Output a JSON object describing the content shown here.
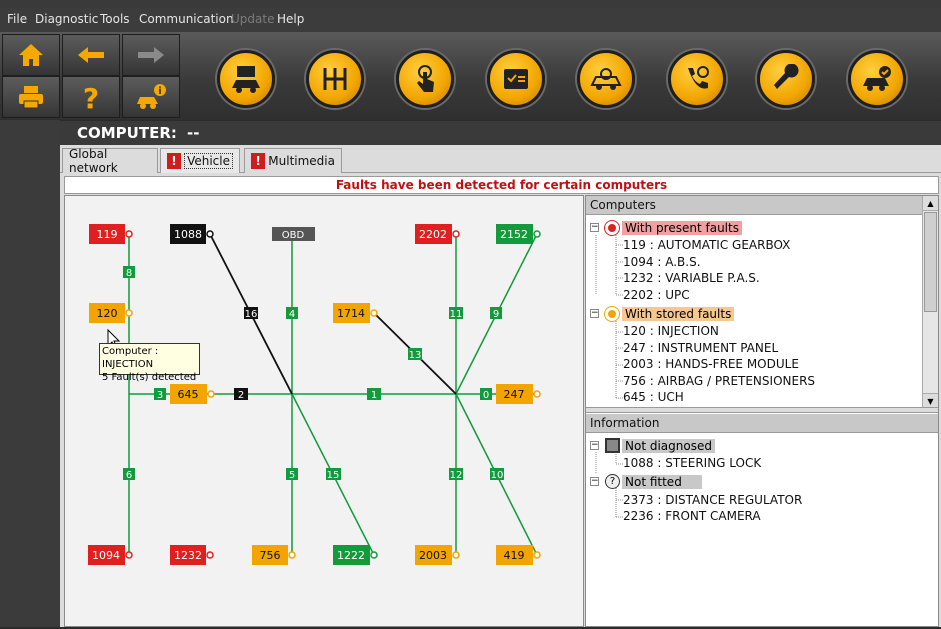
{
  "menu": {
    "file": "File",
    "diagnostic": "Diagnostic",
    "tools": "Tools",
    "communication": "Communication",
    "update": "Update",
    "help": "Help"
  },
  "toolbar": {
    "icons": [
      "home-icon",
      "back-arrow-icon",
      "forward-arrow-icon",
      "printer-icon",
      "help-question-icon",
      "vehicle-info-icon"
    ],
    "function_icons": [
      "vehicle-identification-icon",
      "gearbox-icon",
      "touch-icon",
      "checklist-icon",
      "vehicle-scan-icon",
      "phone-support-icon",
      "wrench-icon",
      "vehicle-check-icon"
    ]
  },
  "computer_bar": {
    "label": "COMPUTER:",
    "value": "--"
  },
  "tabs": {
    "global": "Global network",
    "vehicle": "Vehicle",
    "multimedia": "Multimedia",
    "warn": "!"
  },
  "fault_banner": "Faults have been detected for certain computers",
  "diagram": {
    "nodes": {
      "n119": "119",
      "n1088": "1088",
      "obd": "OBD",
      "n2202": "2202",
      "n2152": "2152",
      "n120": "120",
      "n1714": "1714",
      "n645": "645",
      "n247": "247",
      "n1094": "1094",
      "n1232": "1232",
      "n756": "756",
      "n1222": "1222",
      "n2003": "2003",
      "n419": "419"
    },
    "links": {
      "l8": "8",
      "l16": "16",
      "l4": "4",
      "l11": "11",
      "l9": "9",
      "l13": "13",
      "l3": "3",
      "l2": "2",
      "l1": "1",
      "l0": "0",
      "l6": "6",
      "l5": "5",
      "l15": "15",
      "l12": "12",
      "l10": "10"
    }
  },
  "tooltip": {
    "line1": "Computer : INJECTION",
    "line2": "5 Fault(s) detected"
  },
  "computers": {
    "title": "Computers",
    "present_label": "With present faults",
    "present": [
      "119 : AUTOMATIC GEARBOX",
      "1094 : A.B.S.",
      "1232 : VARIABLE P.A.S.",
      "2202 : UPC"
    ],
    "stored_label": "With stored faults",
    "stored": [
      "120 : INJECTION",
      "247 : INSTRUMENT PANEL",
      "2003 : HANDS-FREE MODULE",
      "756 : AIRBAG / PRETENSIONERS",
      "645 : UCH"
    ]
  },
  "information": {
    "title": "Information",
    "not_diagnosed_label": "Not diagnosed",
    "not_diagnosed": [
      "1088 : STEERING LOCK"
    ],
    "not_fitted_label": "Not fitted",
    "not_fitted": [
      "2373 : DISTANCE REGULATOR",
      "2236 : FRONT CAMERA"
    ]
  },
  "colors": {
    "red_fault": "#e02020",
    "orange_stored": "#f2a400",
    "green_ok": "#129a3c",
    "black_ecu": "#111111",
    "gray_obd": "#555555",
    "present_highlight": "#f0a0a0",
    "stored_highlight": "#f5c890",
    "accent": "#f2a500"
  }
}
